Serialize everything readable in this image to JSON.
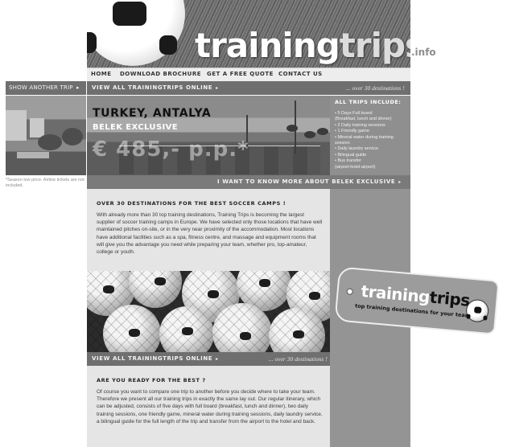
{
  "brand": {
    "logo_main": "training",
    "logo_accent": "trips",
    "logo_tld": ".info"
  },
  "nav": {
    "items": [
      "HOME",
      "DOWNLOAD BROCHURE",
      "GET A FREE QUOTE",
      "CONTACT US"
    ]
  },
  "show_another_trip": "SHOW ANOTHER TRIP",
  "view_all": {
    "label": "VIEW ALL TRAININGTRIPS ONLINE",
    "note": "... over 30 destinations !"
  },
  "hero": {
    "title": "TURKEY, ANTALYA",
    "subtitle": "BELEK EXCLUSIVE",
    "price": "€ 485,- p.p.*"
  },
  "season_note": "*Season low price. Airline tickets are not included.",
  "includes": {
    "title": "ALL TRIPS INCLUDE:",
    "items": [
      "• 5 Days  Full board",
      "  (Breakfast, lunch and dinner)",
      "• 2 Daily training sessions",
      "• 1 Friendly game",
      "• Mineral water during training",
      "  session",
      "• Daily laundry service",
      "• Bilingual guide",
      "• Bus transfer",
      "  (airport-hotel-airport)"
    ]
  },
  "more_link": "I WANT TO KNOW MORE ABOUT BELEK EXCLUSIVE",
  "section1": {
    "title": "OVER 30 DESTINATIONS FOR THE BEST SOCCER CAMPS !",
    "text": "With already more than 30 top training destinations, Training Trips is becoming the largest supplier of soccer training camps in Europe. We have selected only those locations that have well maintained pitches on-site, or in the very near proximity of the accommodation. Most locations have additional facilities such as a spa, fitness centre, and massage and equipment rooms that will give you the advantage you need while preparing your team, whether pro, top-amateur, college or youth."
  },
  "section2": {
    "title": "ARE YOU READY FOR THE BEST ?",
    "text": "Of course you want to compare one trip to another before you decide where to take your team. Therefore we present all our training trips in exactly the same lay out. Our regular itinerary, which can be adjusted, consists of five days with full board (breakfast, lunch and dinner), two daily training sessions, one friendly game, mineral water during training sessions, daily laundry service, a bilingual guide for the full length of the trip and transfer from the airport to the hotel and back."
  },
  "tag": {
    "logo_main": "training",
    "logo_accent": "trips",
    "tagline": "top training destinations for your team"
  }
}
